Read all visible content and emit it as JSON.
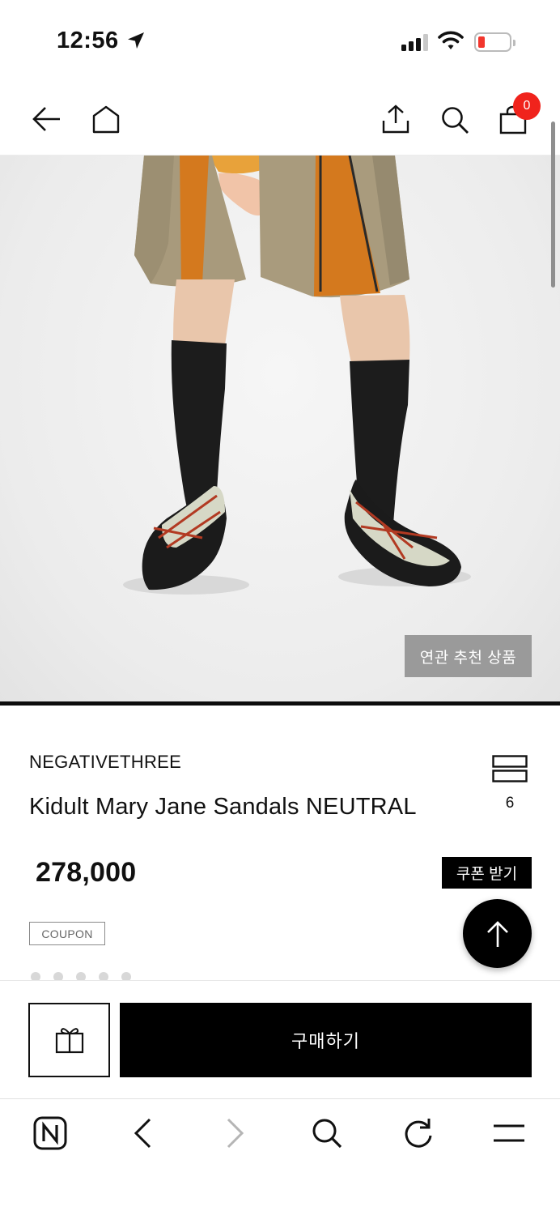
{
  "status_bar": {
    "time": "12:56",
    "battery_color": "#f2362d"
  },
  "top_nav": {
    "icons": [
      "back-arrow-icon",
      "home-icon",
      "share-icon",
      "search-icon",
      "shopping-bag-icon"
    ],
    "cart_count": "0",
    "badge_color": "#f0231c"
  },
  "hero": {
    "related_button": "연관 추천 상품"
  },
  "product": {
    "brand": "NEGATIVETHREE",
    "name": "Kidult Mary Jane Sandals NEUTRAL",
    "price": "278,000",
    "coupon_button": "쿠폰 받기",
    "coupon_tag": "COUPON",
    "list_count": "6"
  },
  "buy_bar": {
    "buy_label": "구매하기",
    "gift_icon": "gift-icon"
  },
  "browser_toolbar": {
    "icons": [
      "naver-n-icon",
      "back-chevron-icon",
      "forward-chevron-icon",
      "search-icon",
      "refresh-icon",
      "menu-icon"
    ]
  }
}
